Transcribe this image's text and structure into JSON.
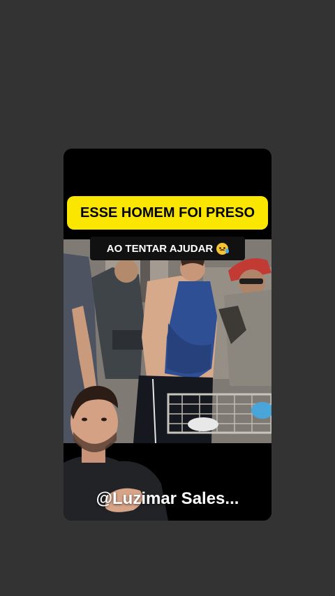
{
  "story": {
    "headline": "ESSE HOMEM FOI PRESO",
    "subtitle": "AO TENTAR AJUDAR",
    "subtitle_emoji": "crying-face-emoji",
    "handle": "@Luzimar Sales..."
  },
  "colors": {
    "background": "#333333",
    "card": "#000000",
    "headline_bg": "#fbe600",
    "subtitle_bg": "#111111"
  }
}
